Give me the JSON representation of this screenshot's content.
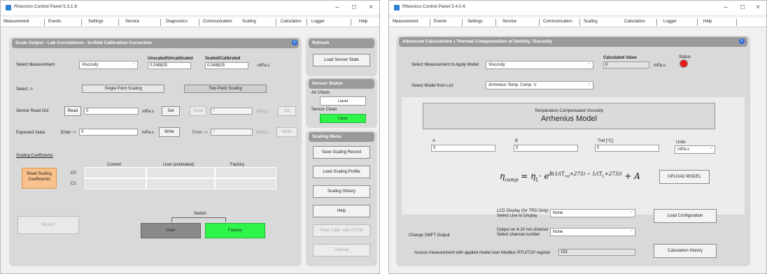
{
  "w1": {
    "title": "Rheonics Control Panel 5.3.1.6",
    "controls": {
      "min": "–",
      "max": "☐",
      "close": "×"
    },
    "menu": [
      "Measurement",
      "Events",
      "Settings",
      "Service",
      "Diagnostics",
      "Communication",
      "Scaling",
      "Calculation",
      "Logger",
      "Help"
    ],
    "main": {
      "header": "Scale Output - Lab Correlations - In-field Calibration Correction",
      "select_measurement_label": "Select Measurement",
      "select_measurement_value": "Viscosity",
      "uncal_label": "Unscaled/Uncalibrated",
      "uncal_value": "0.048825",
      "scaled_label": "Scaled/Calibrated",
      "scaled_value": "0.048825",
      "unit": "mPa.s",
      "select_label": "Select ->",
      "single_point": "Single Point Scaling",
      "two_point": "Two Point Scaling",
      "sensor_readout_label": "Sensor Read Out",
      "read": "Read",
      "set": "Set",
      "readout_value": "0",
      "expected_label": "Expected Value",
      "enter": "Enter ->",
      "expected_value": "0",
      "write": "Write",
      "coeff_title": "Scaling Coefficients",
      "col_current": "Current",
      "col_user": "User (estimated)",
      "col_factory": "Factory",
      "read_coeffs": "Read Scaling Coefficients",
      "c0": "C0",
      "c1": "C1",
      "scale": "SCALE",
      "switch": "Switch",
      "user": "User",
      "factory": "Factory"
    },
    "side": {
      "refresh_header": "Refresh",
      "load_sensor_state": "Load Sensor State",
      "status_header": "Sensor Status",
      "air_check": "Air Check",
      "liquid": "Liquid",
      "sensor_clean": "Sensor Clean",
      "clean": "Clean",
      "scaling_menu_header": "Scaling Menu",
      "save_record": "Save Scaling Record",
      "load_profile": "Load Scaling Profile",
      "history": "Scaling History",
      "help": "Help",
      "field_calib": "Field Calib. with STCM",
      "tutorial": "Tutorial"
    }
  },
  "w2": {
    "title": "Rheonics Control Panel 5.4.0.6",
    "controls": {
      "min": "–",
      "max": "☐",
      "close": "×"
    },
    "menu": [
      "Measurement",
      "Events",
      "Settings",
      "Service",
      "Communication",
      "Scaling",
      "Calculation",
      "Logger",
      "Help"
    ],
    "main": {
      "header": "Advanced Calculations | Thermal Compensation of Density, Viscosity",
      "select_model_label": "Select Measurement to Apply Model",
      "select_model_value": "Viscosity",
      "calc_label": "Calculated Value",
      "calc_value": "0",
      "unit": "mPa.s",
      "status_label": "Status",
      "status_color": "#e81818",
      "model_list_label": "Select Model from List",
      "model_list_value": "Arrhenius Temp. Comp. V",
      "model_box_sub": "Temperature Compensated Viscosity",
      "model_box_title": "Arrhenius Model",
      "a_label": "A",
      "a_value": "0",
      "b_label": "B",
      "b_value": "0",
      "tref_label": "Tref [°C]",
      "tref_value": "0",
      "units_label": "Units",
      "units_value": "mPa.s",
      "upload": "UPLOAD MODEL",
      "change_output": "Change SMFT Output",
      "lcd_label1": "LCD Display (for TRD Only)",
      "lcd_label2": "Select Line to Display",
      "lcd_value": "None",
      "out_label1": "Output on 4-20 mA channel",
      "out_label2": "Select channel number",
      "out_value": "None",
      "load_config": "Load Configuration",
      "modbus_label": "Access measurement with applied model over Modbus RTU/TCP register",
      "modbus_value": "192",
      "calc_history": "Calculation History"
    }
  }
}
